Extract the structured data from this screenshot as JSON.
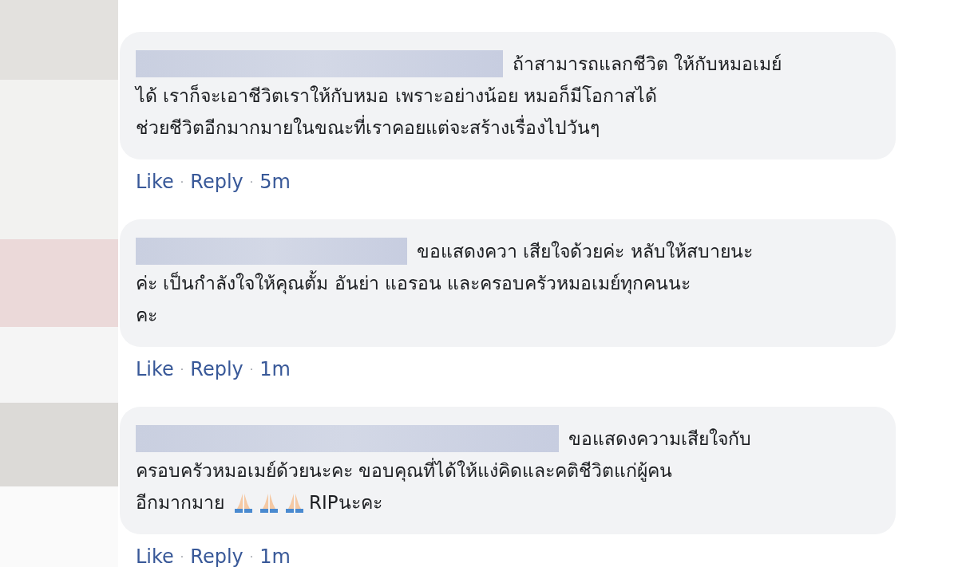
{
  "comments": [
    {
      "lines": [
        [
          {
            "kind": "text",
            "text": "ถ้าสามารถแลกชีวิต ให้กับหมอเมย์"
          }
        ],
        [
          {
            "kind": "text",
            "text": "ได้ เราก็จะเอาชีวิตเราให้กับหมอ เพราะอย่างน้อย หมอก็มีโอกาสได้"
          }
        ],
        [
          {
            "kind": "text",
            "text": "ช่วยชีวิตอีกมากมายในขณะที่เราคอยแต่จะสร้างเรื่องไปวันๆ"
          }
        ]
      ],
      "actions": [
        "Like",
        "Reply"
      ],
      "separator": "·",
      "time": "5m"
    },
    {
      "lines": [
        [
          {
            "kind": "text",
            "text": "ขอแสดงควา เสียใจด้วยค่ะ หลับให้สบายนะ"
          }
        ],
        [
          {
            "kind": "text",
            "text": "ค่ะ เป็นกำลังใจให้คุณตั้ม อันย่า แอรอน และครอบครัวหมอเมย์ทุกคนนะ"
          }
        ],
        [
          {
            "kind": "text",
            "text": "คะ"
          }
        ]
      ],
      "actions": [
        "Like",
        "Reply"
      ],
      "separator": "·",
      "time": "1m"
    },
    {
      "lines": [
        [
          {
            "kind": "text",
            "text": "ขอแสดงความเสียใจกับ"
          }
        ],
        [
          {
            "kind": "text",
            "text": "ครอบครัวหมอเมย์ด้วยนะคะ ขอบคุณที่ได้ให้แง่คิดและคติชีวิตแก่ผู้คน"
          }
        ],
        [
          {
            "kind": "text",
            "text": "อีกมากมาย"
          },
          {
            "kind": "prayer"
          },
          {
            "kind": "prayer"
          },
          {
            "kind": "prayer"
          },
          {
            "kind": "text",
            "text": "RIPนะคะ"
          }
        ]
      ],
      "actions": [
        "Like",
        "Reply"
      ],
      "separator": "·",
      "time": "1m"
    }
  ]
}
